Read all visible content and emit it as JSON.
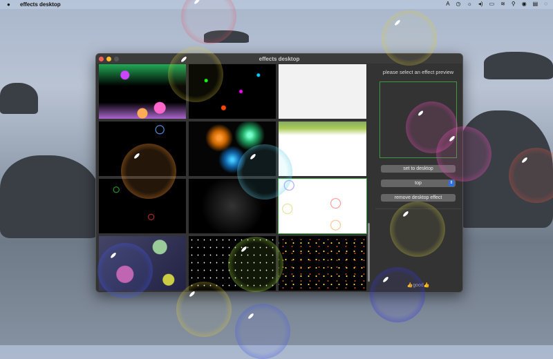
{
  "menubar": {
    "app_name": "effects desktop",
    "status_icons": [
      "input-source-icon",
      "time-machine-icon",
      "brightness-icon",
      "volume-icon",
      "battery-icon",
      "wifi-icon",
      "search-icon",
      "user-icon",
      "control-center-icon",
      "siri-icon"
    ]
  },
  "window": {
    "title": "effects desktop"
  },
  "grid": {
    "effects": [
      "confetti-dots",
      "emoji-symbols",
      "white-texture",
      "bubbles-dark",
      "fireworks",
      "leaves",
      "circles-dark",
      "sparkle-stars",
      "rings-white",
      "bokeh",
      "stars",
      "colorful-confetti"
    ],
    "selected_index": 8
  },
  "sidebar": {
    "prompt": "please select an effect preview",
    "set_button": "set to desktop",
    "position_select": "top",
    "remove_button": "remove desktop effect",
    "footer": "👍good👍"
  },
  "colors": {
    "accent": "#2f6fe0",
    "selection": "#3aa13a"
  }
}
